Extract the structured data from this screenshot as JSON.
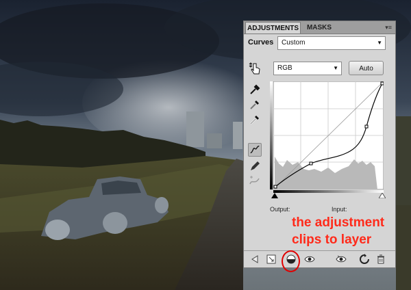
{
  "panel": {
    "tabs": [
      {
        "label": "ADJUSTMENTS",
        "active": true
      },
      {
        "label": "MASKS",
        "active": false
      }
    ],
    "menu_icon": "panel-menu-icon",
    "preset_label": "Curves",
    "preset_value": "Custom",
    "channel_value": "RGB",
    "auto_label": "Auto",
    "output_label": "Output:",
    "input_label": "Input:",
    "tools": [
      "on-image-adjust-icon",
      "eyedropper-black-icon",
      "eyedropper-gray-icon",
      "eyedropper-white-icon",
      "curve-point-tool-icon",
      "pencil-tool-icon",
      "smooth-curve-icon"
    ],
    "footer_icons": [
      "back-arrow-icon",
      "expand-view-icon",
      "clip-to-layer-icon",
      "visibility-eye-icon",
      "view-previous-icon",
      "reset-icon",
      "trash-icon"
    ]
  },
  "annotation": {
    "line1": "the adjustment",
    "line2": "clips to layer",
    "color": "#ff2a1a"
  }
}
